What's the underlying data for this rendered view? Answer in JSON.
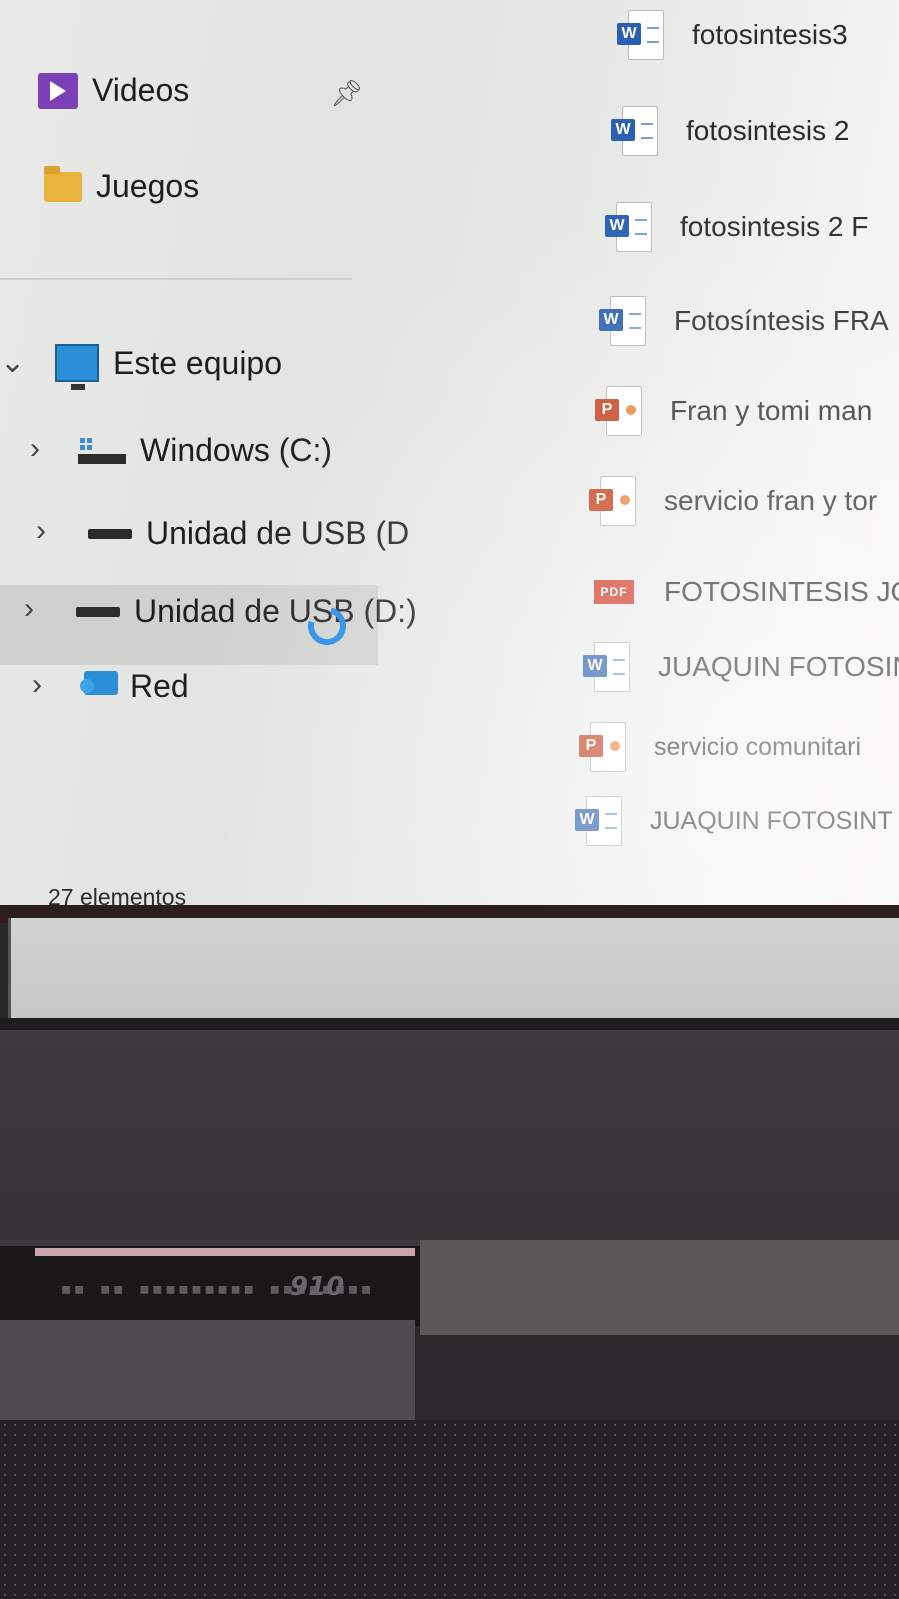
{
  "sidebar": {
    "items": [
      {
        "label": "Videos",
        "icon": "video-folder-icon",
        "pinned": true
      },
      {
        "label": "Juegos",
        "icon": "folder-icon"
      },
      {
        "label": "Este equipo",
        "icon": "computer-icon",
        "expanded": true
      },
      {
        "label": "Windows (C:)",
        "icon": "windows-drive-icon"
      },
      {
        "label": "Unidad de USB (D",
        "icon": "usb-drive-icon"
      },
      {
        "label": "Unidad de USB (D:)",
        "icon": "usb-drive-icon",
        "selected": true
      },
      {
        "label": "Red",
        "icon": "network-icon"
      }
    ]
  },
  "files": [
    {
      "name": "fotosintesis3",
      "type": "word"
    },
    {
      "name": "fotosintesis 2",
      "type": "word"
    },
    {
      "name": "fotosintesis 2 F",
      "type": "word"
    },
    {
      "name": "Fotosíntesis FRA",
      "type": "word"
    },
    {
      "name": "Fran y tomi man",
      "type": "powerpoint"
    },
    {
      "name": "servicio fran y tor",
      "type": "powerpoint"
    },
    {
      "name": "FOTOSINTESIS JO",
      "type": "pdf"
    },
    {
      "name": "JUAQUIN FOTOSIN",
      "type": "word"
    },
    {
      "name": "servicio comunitari",
      "type": "powerpoint"
    },
    {
      "name": "JUAQUIN FOTOSINT",
      "type": "word"
    }
  ],
  "icons": {
    "word_badge": "W",
    "ppt_badge": "P",
    "pdf_badge": "PDF"
  },
  "status": {
    "item_count": "27 elementos"
  },
  "laptop": {
    "model_label": "910"
  },
  "colors": {
    "selection": "#cfd1cf",
    "word": "#2b5fb3",
    "powerpoint": "#c43e1c",
    "pdf": "#d03a26",
    "spinner": "#1e88e5"
  }
}
